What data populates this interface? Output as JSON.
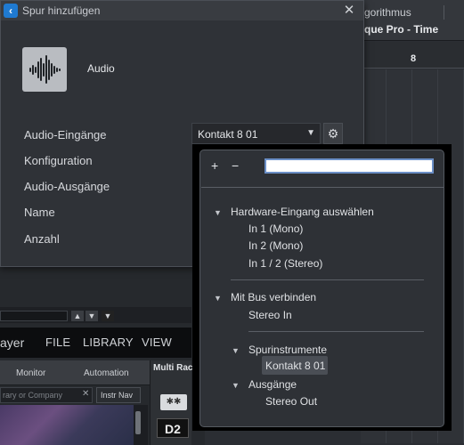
{
  "background": {
    "algo_label": "gorithmus",
    "algo_value": "que Pro - Time",
    "ruler_bar": "8",
    "player_label": "ayer",
    "menu": [
      "FILE",
      "LIBRARY",
      "VIEW"
    ],
    "tabs": [
      "Monitor",
      "Automation"
    ],
    "search_placeholder": "rary or Company",
    "nav_label": "Instr Nav",
    "rack_label": "Multi Rack",
    "logo_text": "D2"
  },
  "dialog": {
    "title": "Spur hinzufügen",
    "track_type": "Audio",
    "fields": {
      "inputs": "Audio-Eingänge",
      "config": "Konfiguration",
      "outputs": "Audio-Ausgänge",
      "name": "Name",
      "count": "Anzahl"
    },
    "input_value": "Kontakt 8 01"
  },
  "dropdown": {
    "add_label": "+",
    "remove_label": "−",
    "filter_value": "",
    "groups": {
      "hardware": {
        "label": "Hardware-Eingang auswählen",
        "items": [
          "In 1 (Mono)",
          "In 2 (Mono)",
          "In 1 / 2 (Stereo)"
        ]
      },
      "bus": {
        "label": "Mit Bus verbinden",
        "items": [
          "Stereo In"
        ]
      },
      "instruments": {
        "label": "Spurinstrumente",
        "items": [
          "Kontakt 8 01"
        ]
      },
      "outputs": {
        "label": "Ausgänge",
        "items": [
          "Stereo Out"
        ]
      }
    },
    "selected": "Kontakt 8 01"
  },
  "icons": {
    "app": "cubase-icon",
    "waveform": "waveform-icon",
    "gear": "gear-icon",
    "close": "close-icon",
    "chevron": "chevron-down-icon"
  }
}
